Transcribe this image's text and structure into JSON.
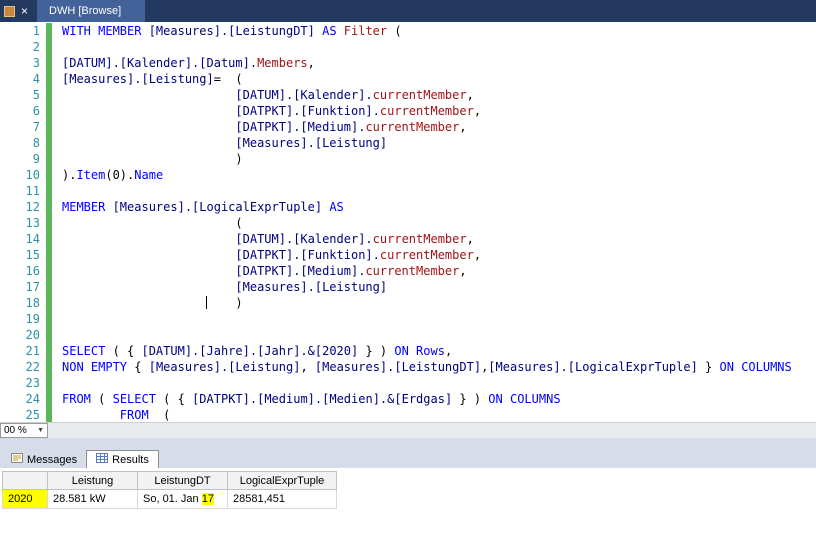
{
  "titlebar": {
    "tab_title": "DWH [Browse]",
    "close_glyph": "×"
  },
  "editor": {
    "zoom": {
      "value": "00 %"
    },
    "caret": {
      "line": 18,
      "col": 20
    },
    "lines": [
      {
        "n": "1",
        "segs": [
          [
            "kw",
            "WITH MEMBER "
          ],
          [
            "id",
            "[Measures].[LeistungDT] "
          ],
          [
            "kw",
            "AS "
          ],
          [
            "fn",
            "Filter"
          ],
          [
            "pl",
            " ("
          ]
        ]
      },
      {
        "n": "2",
        "segs": []
      },
      {
        "n": "3",
        "segs": [
          [
            "id",
            "[DATUM].[Kalender].[Datum]."
          ],
          [
            "fn",
            "Members"
          ],
          [
            "pl",
            ","
          ]
        ]
      },
      {
        "n": "4",
        "segs": [
          [
            "id",
            "[Measures].[Leistung]"
          ],
          [
            "pl",
            "=  ("
          ]
        ]
      },
      {
        "n": "5",
        "segs": [
          [
            "pl",
            "                        "
          ],
          [
            "id",
            "[DATUM].[Kalender]."
          ],
          [
            "fn",
            "currentMember"
          ],
          [
            "pl",
            ","
          ]
        ]
      },
      {
        "n": "6",
        "segs": [
          [
            "pl",
            "                        "
          ],
          [
            "id",
            "[DATPKT].[Funktion]."
          ],
          [
            "fn",
            "currentMember"
          ],
          [
            "pl",
            ","
          ]
        ]
      },
      {
        "n": "7",
        "segs": [
          [
            "pl",
            "                        "
          ],
          [
            "id",
            "[DATPKT].[Medium]."
          ],
          [
            "fn",
            "currentMember"
          ],
          [
            "pl",
            ","
          ]
        ]
      },
      {
        "n": "8",
        "segs": [
          [
            "pl",
            "                        "
          ],
          [
            "id",
            "[Measures].[Leistung]"
          ]
        ]
      },
      {
        "n": "9",
        "segs": [
          [
            "pl",
            "                        )"
          ]
        ]
      },
      {
        "n": "10",
        "segs": [
          [
            "pl",
            ")."
          ],
          [
            "kw",
            "Item"
          ],
          [
            "pl",
            "(0)."
          ],
          [
            "kw",
            "Name"
          ]
        ]
      },
      {
        "n": "11",
        "segs": []
      },
      {
        "n": "12",
        "segs": [
          [
            "kw",
            "MEMBER "
          ],
          [
            "id",
            "[Measures].[LogicalExprTuple] "
          ],
          [
            "kw",
            "AS"
          ]
        ]
      },
      {
        "n": "13",
        "segs": [
          [
            "pl",
            "                        ("
          ]
        ]
      },
      {
        "n": "14",
        "segs": [
          [
            "pl",
            "                        "
          ],
          [
            "id",
            "[DATUM].[Kalender]."
          ],
          [
            "fn",
            "currentMember"
          ],
          [
            "pl",
            ","
          ]
        ]
      },
      {
        "n": "15",
        "segs": [
          [
            "pl",
            "                        "
          ],
          [
            "id",
            "[DATPKT].[Funktion]."
          ],
          [
            "fn",
            "currentMember"
          ],
          [
            "pl",
            ","
          ]
        ]
      },
      {
        "n": "16",
        "segs": [
          [
            "pl",
            "                        "
          ],
          [
            "id",
            "[DATPKT].[Medium]."
          ],
          [
            "fn",
            "currentMember"
          ],
          [
            "pl",
            ","
          ]
        ]
      },
      {
        "n": "17",
        "segs": [
          [
            "pl",
            "                        "
          ],
          [
            "id",
            "[Measures].[Leistung]"
          ]
        ]
      },
      {
        "n": "18",
        "segs": [
          [
            "pl",
            "                        )"
          ]
        ],
        "caret_col": 20
      },
      {
        "n": "19",
        "segs": []
      },
      {
        "n": "20",
        "segs": []
      },
      {
        "n": "21",
        "segs": [
          [
            "kw",
            "SELECT"
          ],
          [
            "pl",
            " ( { "
          ],
          [
            "id",
            "[DATUM].[Jahre].[Jahr].&[2020]"
          ],
          [
            "pl",
            " } ) "
          ],
          [
            "kw",
            "ON"
          ],
          [
            "pl",
            " "
          ],
          [
            "kw",
            "Rows"
          ],
          [
            "pl",
            ","
          ]
        ]
      },
      {
        "n": "22",
        "segs": [
          [
            "kw",
            "NON EMPTY"
          ],
          [
            "pl",
            " { "
          ],
          [
            "id",
            "[Measures].[Leistung]"
          ],
          [
            "pl",
            ", "
          ],
          [
            "id",
            "[Measures].[LeistungDT]"
          ],
          [
            "pl",
            ","
          ],
          [
            "id",
            "[Measures].[LogicalExprTuple]"
          ],
          [
            "pl",
            " } "
          ],
          [
            "kw",
            "ON"
          ],
          [
            "pl",
            " "
          ],
          [
            "kw",
            "COLUMNS"
          ]
        ]
      },
      {
        "n": "23",
        "segs": []
      },
      {
        "n": "24",
        "segs": [
          [
            "kw",
            "FROM"
          ],
          [
            "pl",
            " ( "
          ],
          [
            "kw",
            "SELECT"
          ],
          [
            "pl",
            " ( { "
          ],
          [
            "id",
            "[DATPKT].[Medium].[Medien].&[Erdgas]"
          ],
          [
            "pl",
            " } ) "
          ],
          [
            "kw",
            "ON"
          ],
          [
            "pl",
            " "
          ],
          [
            "kw",
            "COLUMNS"
          ]
        ]
      },
      {
        "n": "25",
        "segs": [
          [
            "pl",
            "        "
          ],
          [
            "kw",
            "FROM"
          ],
          [
            "pl",
            "  ("
          ]
        ]
      }
    ]
  },
  "bottom_tabs": [
    {
      "label": "Messages",
      "active": false
    },
    {
      "label": "Results",
      "active": true
    }
  ],
  "results_grid": {
    "columns": [
      "",
      "Leistung",
      "LeistungDT",
      "LogicalExprTuple"
    ],
    "rows": [
      {
        "cells": [
          {
            "text": "2020",
            "cell_highlight": true
          },
          {
            "text": "28.581 kW"
          },
          {
            "parts": [
              {
                "text": "So, 01. Jan "
              },
              {
                "text": "17",
                "highlight": true
              }
            ]
          },
          {
            "text": "28581,451"
          }
        ]
      }
    ]
  },
  "colors": {
    "keyword": "#0000ff",
    "identifier": "#000080",
    "function": "#a31515",
    "plain": "#000000",
    "line_number": "#2b91af",
    "change_bar": "#5bb75b",
    "highlight": "#ffff00",
    "titlebar_bg": "#24395f",
    "active_tab_bg": "#44629a"
  }
}
